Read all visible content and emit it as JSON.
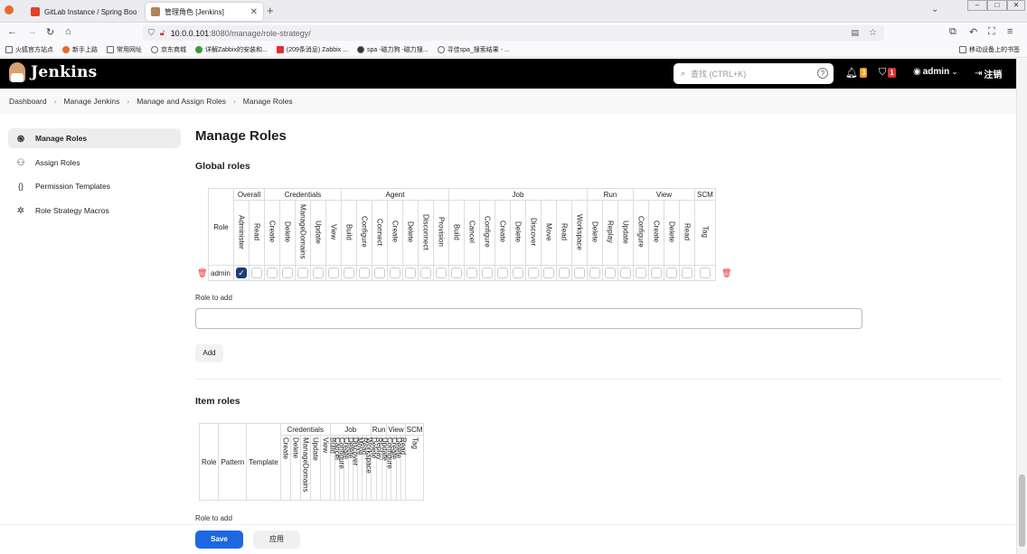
{
  "browser": {
    "tabs": [
      {
        "title": "GitLab Instance / Spring Boo",
        "active": false
      },
      {
        "title": "管理角色 [Jenkins]",
        "active": true
      }
    ],
    "url_host": "10.0.0.101",
    "url_path": ":8080/manage/role-strategy/",
    "bookmarks": [
      "火狐官方站点",
      "新手上路",
      "常用网址",
      "京东商城",
      "详解Zabbix的安装和...",
      "(209条消息) Zabbix ...",
      "spa -磁力狗 -磁力搜...",
      "寻佳spa_搜索结果 - ..."
    ],
    "mobile_bookmarks": "移动设备上的书签"
  },
  "header": {
    "app_name": "Jenkins",
    "search_placeholder": "查找 (CTRL+K)",
    "search_help": "?",
    "notifications_count": "3",
    "security_count": "1",
    "user": "admin",
    "logout": "注销"
  },
  "breadcrumb": [
    "Dashboard",
    "Manage Jenkins",
    "Manage and Assign Roles",
    "Manage Roles"
  ],
  "sidebar": [
    {
      "label": "Manage Roles",
      "icon": "fingerprint-icon",
      "active": true
    },
    {
      "label": "Assign Roles",
      "icon": "users-icon",
      "active": false
    },
    {
      "label": "Permission Templates",
      "icon": "braces-icon",
      "active": false
    },
    {
      "label": "Role Strategy Macros",
      "icon": "puzzle-icon",
      "active": false
    }
  ],
  "page_title": "Manage Roles",
  "global_roles": {
    "heading": "Global roles",
    "role_header": "Role",
    "groups": [
      {
        "name": "Overall",
        "perms": [
          "Administer",
          "Read"
        ]
      },
      {
        "name": "Credentials",
        "perms": [
          "Create",
          "Delete",
          "ManageDomains",
          "Update",
          "View"
        ]
      },
      {
        "name": "Agent",
        "perms": [
          "Build",
          "Configure",
          "Connect",
          "Create",
          "Delete",
          "Disconnect",
          "Provision"
        ]
      },
      {
        "name": "Job",
        "perms": [
          "Build",
          "Cancel",
          "Configure",
          "Create",
          "Delete",
          "Discover",
          "Move",
          "Read",
          "Workspace"
        ]
      },
      {
        "name": "Run",
        "perms": [
          "Delete",
          "Replay",
          "Update"
        ]
      },
      {
        "name": "View",
        "perms": [
          "Configure",
          "Create",
          "Delete",
          "Read"
        ]
      },
      {
        "name": "SCM",
        "perms": [
          "Tag"
        ]
      }
    ],
    "rows": [
      {
        "role": "admin",
        "checked_index": 0
      }
    ],
    "role_to_add_label": "Role to add",
    "add_button": "Add"
  },
  "item_roles": {
    "heading": "Item roles",
    "fixed_headers": [
      "Role",
      "Pattern",
      "Template"
    ],
    "groups": [
      {
        "name": "Credentials",
        "perms": [
          "Create",
          "Delete",
          "ManageDomains",
          "Update",
          "View"
        ]
      },
      {
        "name": "Job",
        "perms": [
          "Build",
          "Cancel",
          "Configure",
          "Create",
          "Delete",
          "Discover",
          "Move",
          "Read",
          "Workspace"
        ]
      },
      {
        "name": "Run",
        "perms": [
          "Delete",
          "Replay",
          "Update"
        ]
      },
      {
        "name": "View",
        "perms": [
          "Configure",
          "Create",
          "Delete",
          "Read"
        ]
      },
      {
        "name": "SCM",
        "perms": [
          "Tag"
        ]
      }
    ],
    "role_to_add_label": "Role to add"
  },
  "footer": {
    "save_button": "Save",
    "apply_button": "应用"
  },
  "colors": {
    "header_bg": "#000000",
    "primary": "#1d68e0",
    "checked": "#1c3b78",
    "notify_badge": "#f19a1c",
    "security_badge": "#e03030"
  }
}
